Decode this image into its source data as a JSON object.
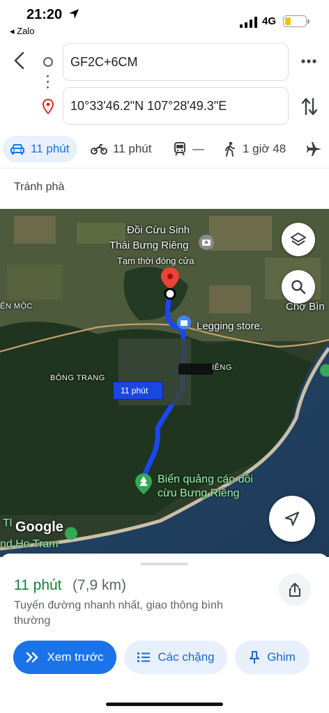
{
  "status_bar": {
    "time": "21:20",
    "back_app": "◂ Zalo",
    "network": "4G"
  },
  "route": {
    "origin": "GF2C+6CM",
    "destination": "10°33'46.2\"N 107°28'49.3\"E"
  },
  "modes": [
    {
      "name": "car",
      "icon": "car-icon",
      "label": "11 phút",
      "active": true
    },
    {
      "name": "motorbike",
      "icon": "motorbike-icon",
      "label": "11 phút"
    },
    {
      "name": "transit",
      "icon": "train-icon",
      "label": "—"
    },
    {
      "name": "walk",
      "icon": "walk-icon",
      "label": "1 giờ 48"
    },
    {
      "name": "flight",
      "icon": "airplane-icon",
      "label": ""
    }
  ],
  "avoid_option": "Tránh phà",
  "map": {
    "labels": {
      "poi_name_line1": "Đồi Cừu Sinh",
      "poi_name_line2": "Thái Bưng Riêng",
      "poi_status": "Tạm thời đóng cửa",
      "legging_store": "Legging store.",
      "cho_binh": "Chợ Bìn",
      "ben_moc": "ẾN MỘC",
      "bong_trang": "BÔNG TRANG",
      "rieng": "IÊNG",
      "billboard_line1": "Biển quảng cáo đồi",
      "billboard_line2": "cừu Bưng Riêng",
      "ho_tram_line1": "Tl",
      "ho_tram_line2": "nd Ho Tram",
      "route_time_bubble": "11 phút",
      "google_logo": "Google"
    },
    "colors": {
      "route": "#1a47f5",
      "destination_pin": "#ea4335",
      "poi_green": "#34a853"
    }
  },
  "sheet": {
    "duration": "11 phút",
    "distance": "(7,9 km)",
    "description": "Tuyến đường nhanh nhất, giao thông bình thường",
    "buttons": {
      "preview": "Xem trước",
      "steps": "Các chặng",
      "pin": "Ghim"
    }
  }
}
